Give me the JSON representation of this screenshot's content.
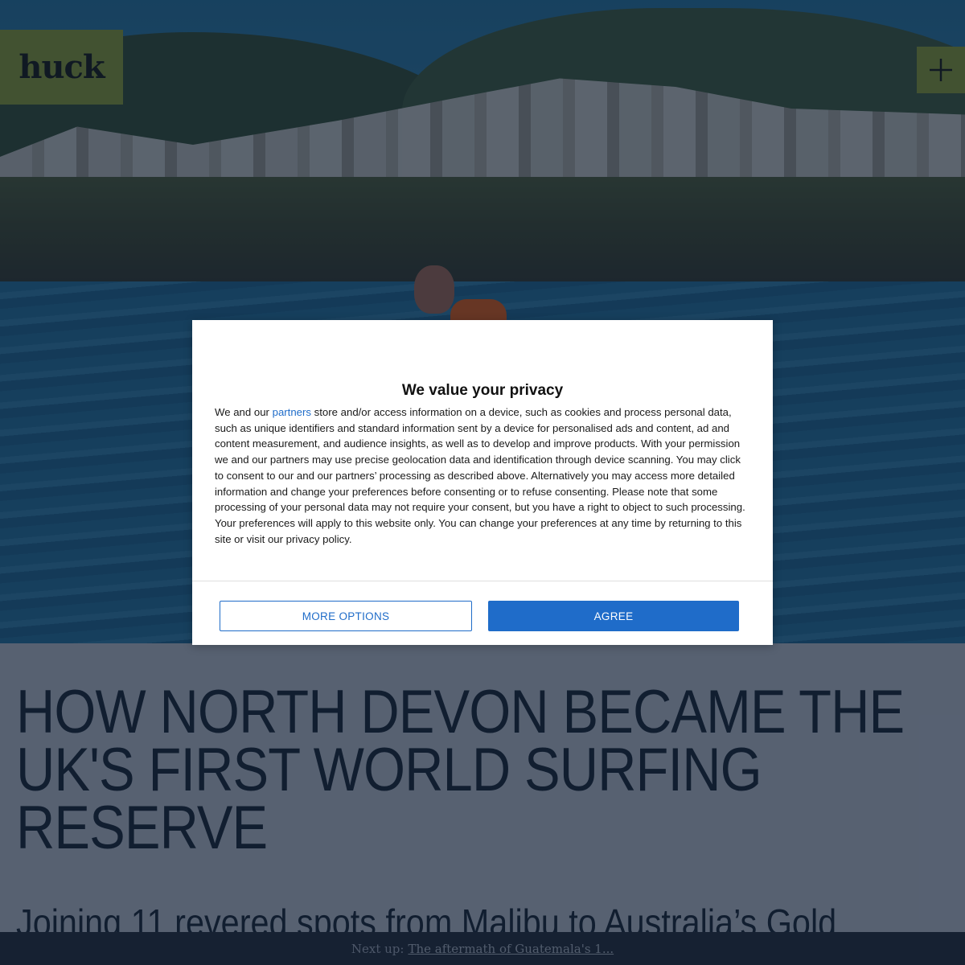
{
  "header": {
    "logo": "huck",
    "menu_icon": "plus-icon"
  },
  "article": {
    "headline": "HOW NORTH DEVON BECAME THE UK'S FIRST WORLD SURFING RESERVE",
    "subheadline": "Joining 11 revered spots from Malibu to Australia’s Gold"
  },
  "next_up": {
    "label": "Next up:",
    "link_text": "The aftermath of Guatemala's 1..."
  },
  "consent": {
    "title": "We value your privacy",
    "body_before_link": "We and our ",
    "partners_link": "partners",
    "body_after_link": " store and/or access information on a device, such as cookies and process personal data, such as unique identifiers and standard information sent by a device for personalised ads and content, ad and content measurement, and audience insights, as well as to develop and improve products. With your permission we and our partners may use precise geolocation data and identification through device scanning. You may click to consent to our and our partners’ processing as described above. Alternatively you may access more detailed information and change your preferences before consenting or to refuse consenting. Please note that some processing of your personal data may not require your consent, but you have a right to object to such processing. Your preferences will apply to this website only. You can change your preferences at any time by returning to this site or visit our privacy policy.",
    "more_options_label": "MORE OPTIONS",
    "agree_label": "AGREE"
  },
  "colors": {
    "brand_green": "#9fb43a",
    "consent_blue": "#1f6cc9",
    "headline_text": "#1f2a38",
    "next_bar": "#2a323d"
  }
}
